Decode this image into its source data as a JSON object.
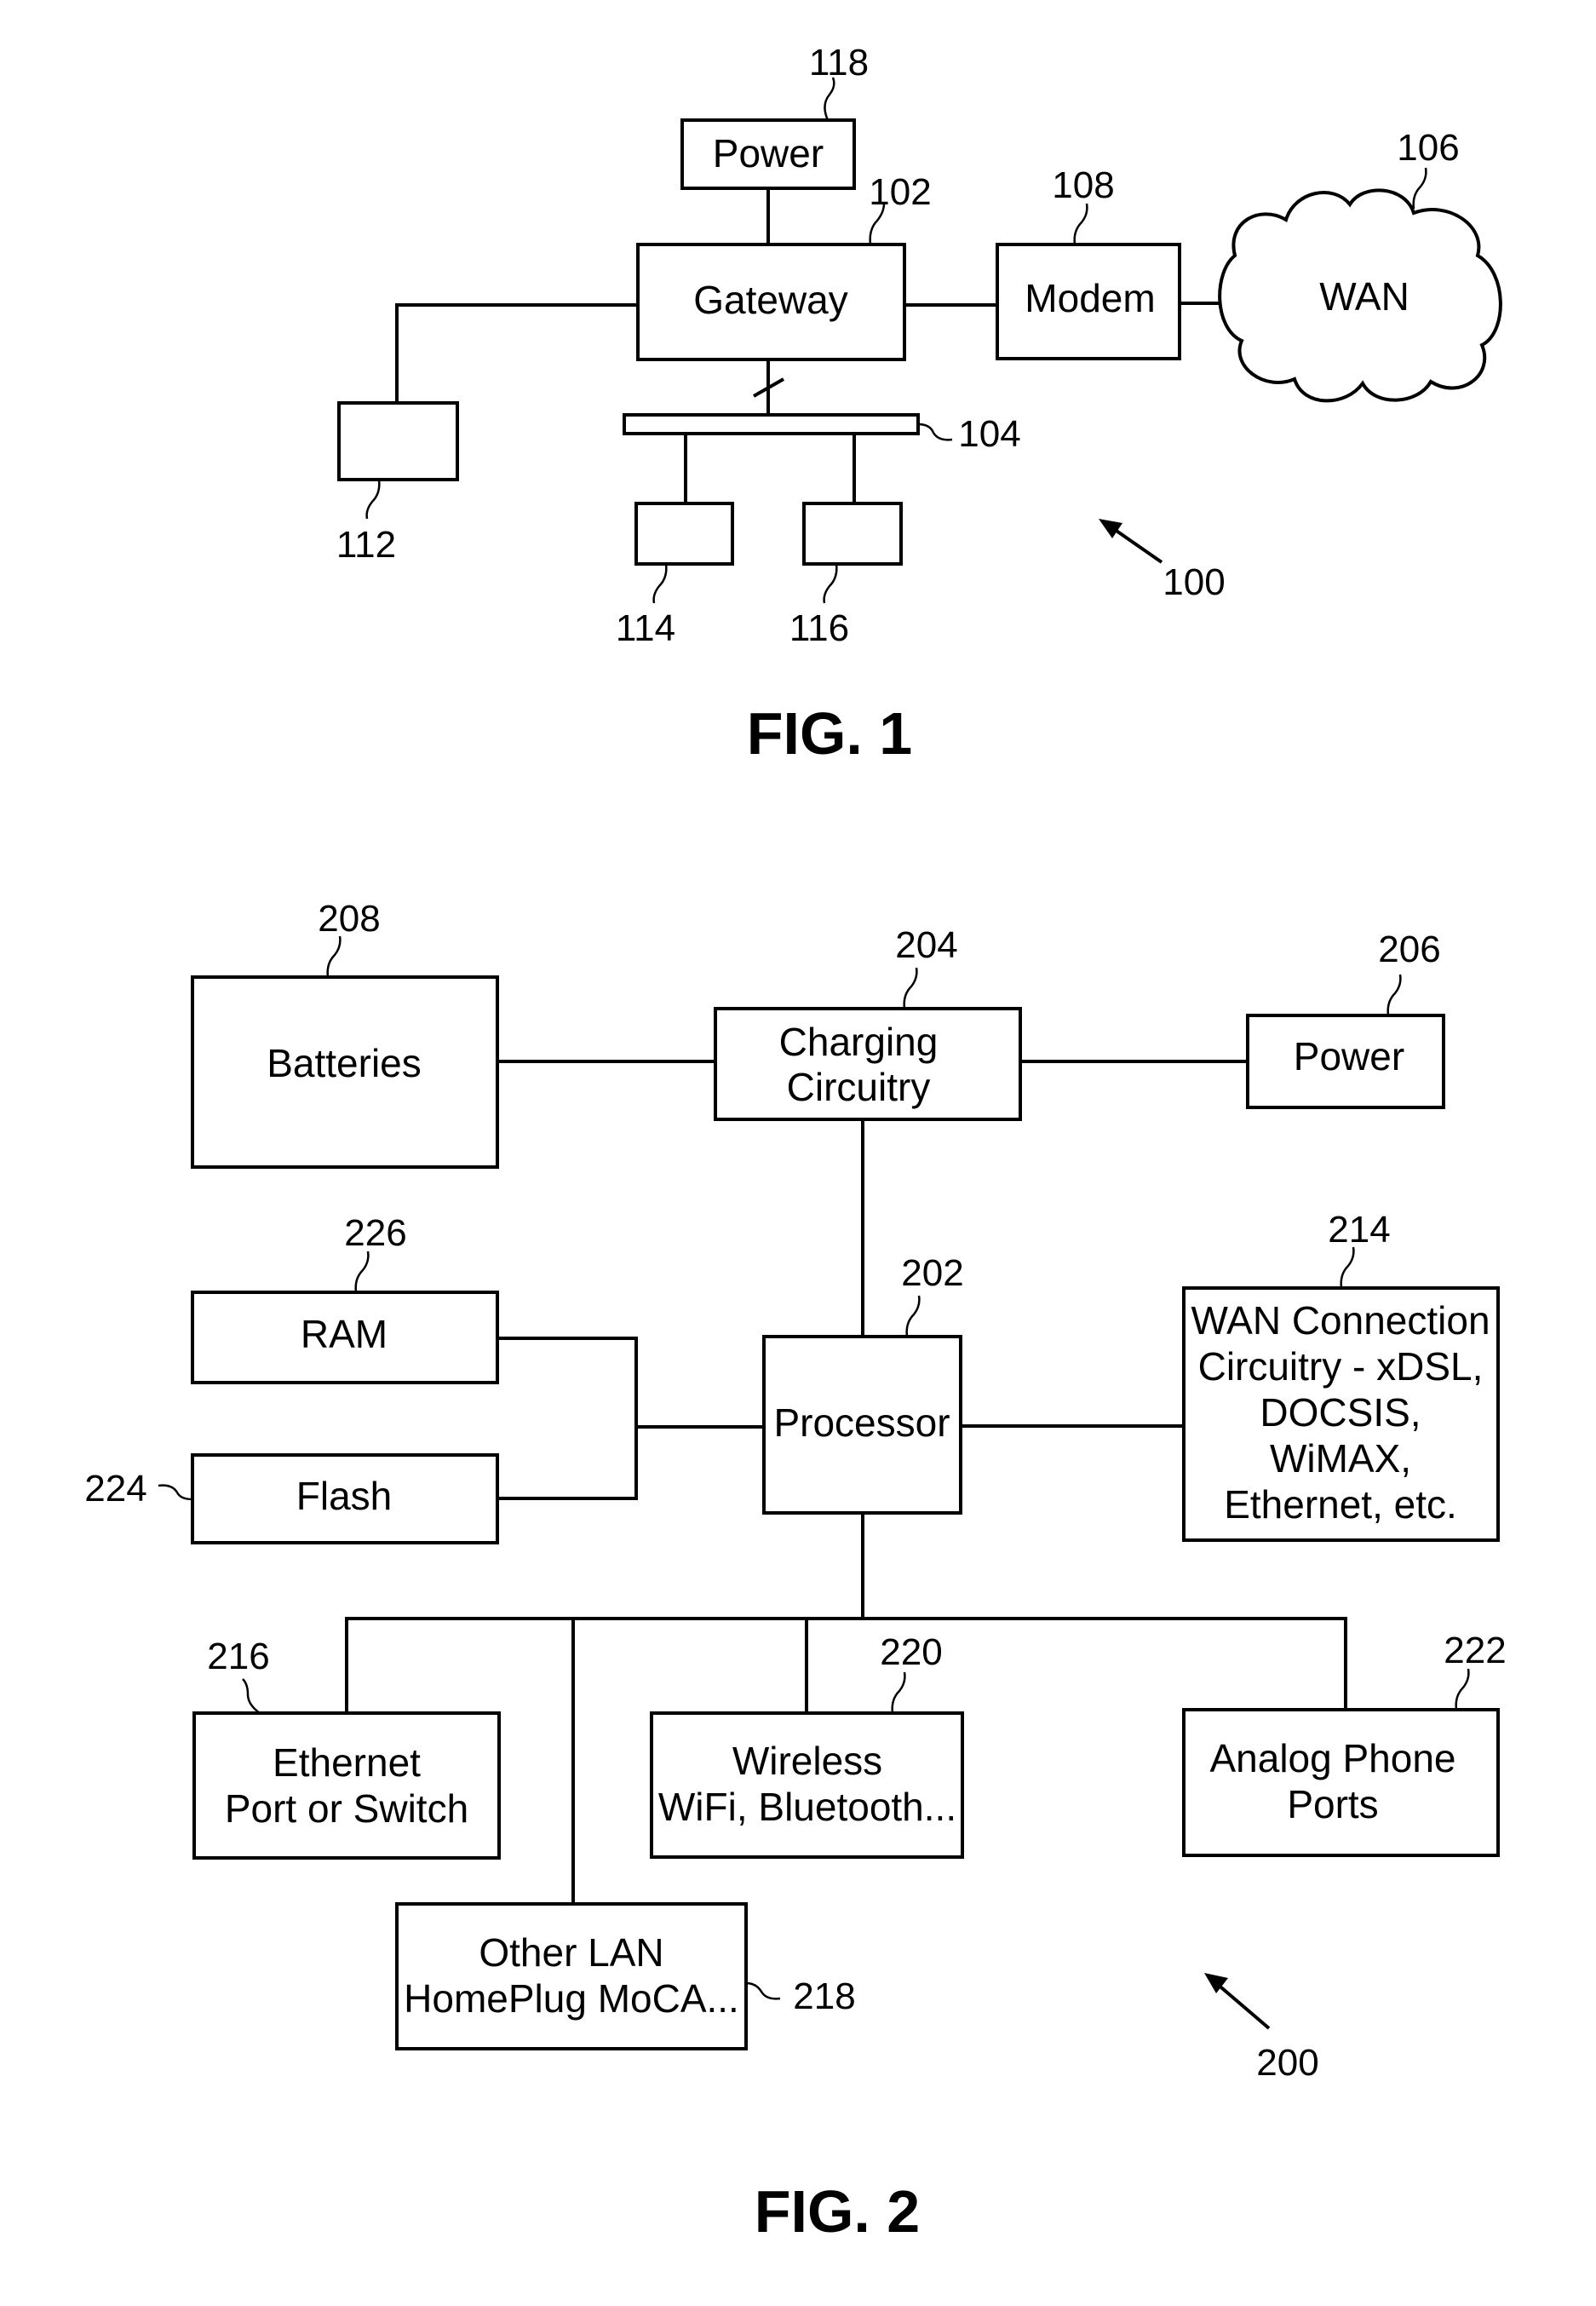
{
  "fig1": {
    "caption": "FIG. 1",
    "system_ref": "100",
    "blocks": {
      "power": {
        "label": "Power",
        "ref": "118"
      },
      "gateway": {
        "label": "Gateway",
        "ref": "102"
      },
      "modem": {
        "label": "Modem",
        "ref": "108"
      },
      "wan": {
        "label": "WAN",
        "ref": "106"
      },
      "bus": {
        "label": "",
        "ref": "104"
      },
      "device112": {
        "label": "",
        "ref": "112"
      },
      "device114": {
        "label": "",
        "ref": "114"
      },
      "device116": {
        "label": "",
        "ref": "116"
      }
    }
  },
  "fig2": {
    "caption": "FIG. 2",
    "system_ref": "200",
    "blocks": {
      "batteries": {
        "label": "Batteries",
        "ref": "208"
      },
      "charging": {
        "line1": "Charging",
        "line2": "Circuitry",
        "ref": "204"
      },
      "power": {
        "label": "Power",
        "ref": "206"
      },
      "ram": {
        "label": "RAM",
        "ref": "226"
      },
      "flash": {
        "label": "Flash",
        "ref": "224"
      },
      "processor": {
        "label": "Processor",
        "ref": "202"
      },
      "wan_conn": {
        "lines": [
          "WAN Connection",
          "Circuitry - xDSL,",
          "DOCSIS,",
          "WiMAX,",
          "Ethernet, etc."
        ],
        "ref": "214"
      },
      "ethernet": {
        "line1": "Ethernet",
        "line2": "Port or Switch",
        "ref": "216"
      },
      "wireless": {
        "line1": "Wireless",
        "line2": "WiFi, Bluetooth...",
        "ref": "220"
      },
      "analog": {
        "line1": "Analog Phone",
        "line2": "Ports",
        "ref": "222"
      },
      "other_lan": {
        "line1": "Other LAN",
        "line2": "HomePlug MoCA...",
        "ref": "218"
      }
    }
  }
}
